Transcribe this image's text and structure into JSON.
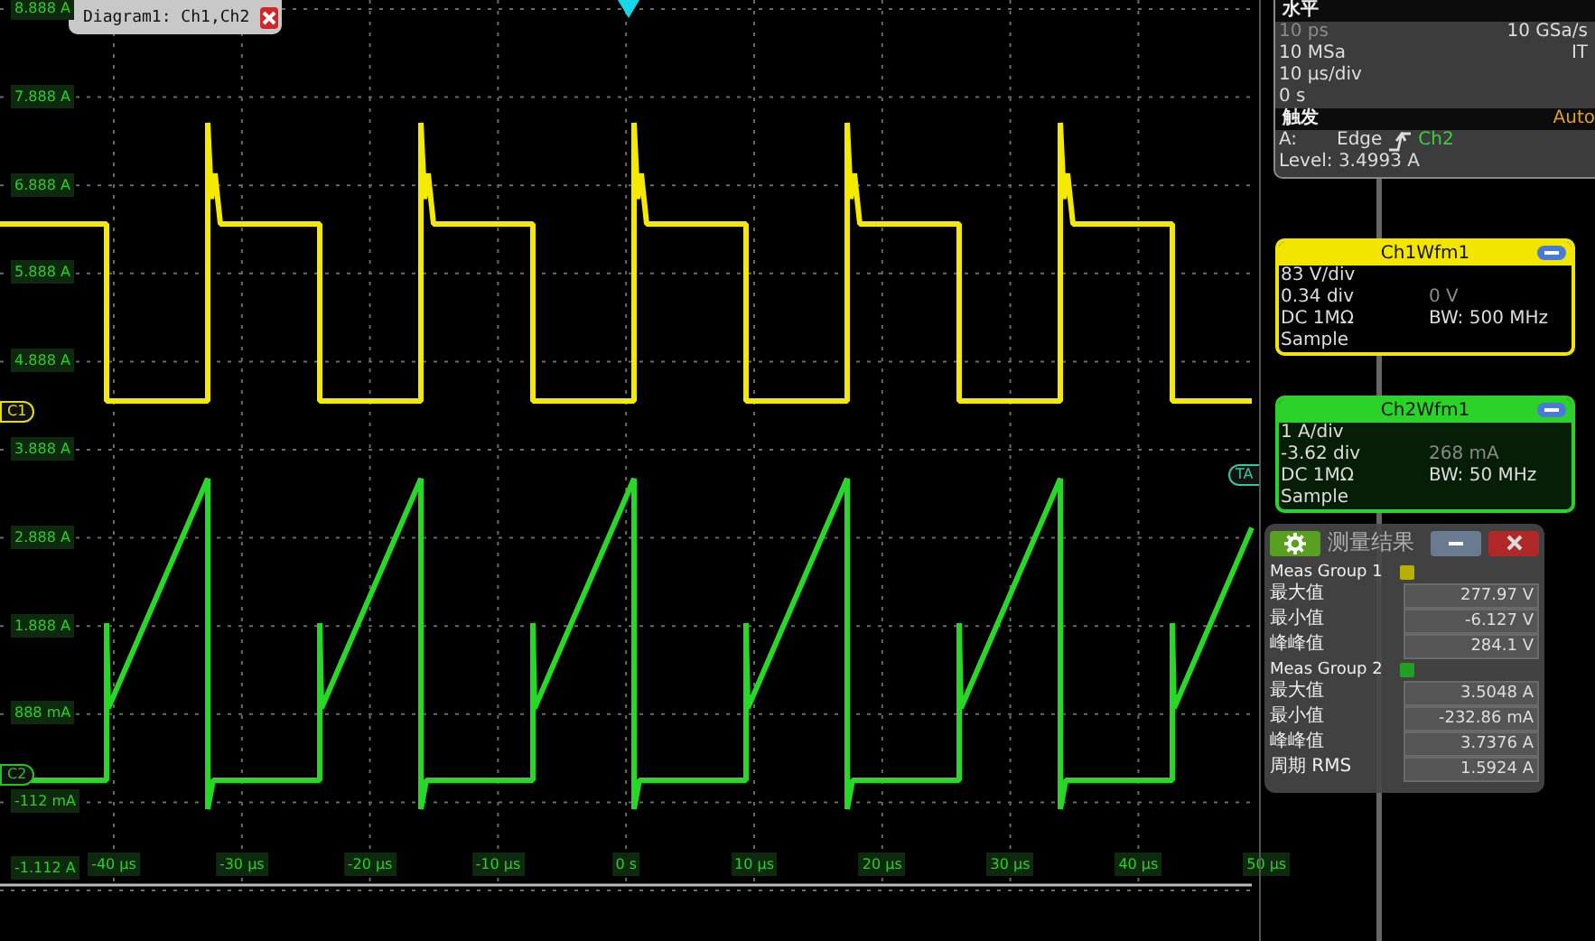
{
  "diagram_tab": {
    "title": "Diagram1: Ch1,Ch2"
  },
  "y_axis_labels": [
    "8.888 A",
    "7.888 A",
    "6.888 A",
    "5.888 A",
    "4.888 A",
    "3.888 A",
    "2.888 A",
    "1.888 A",
    "888 mA",
    "-112 mA",
    "-1.112 A"
  ],
  "x_axis_labels": [
    "-40 µs",
    "-30 µs",
    "-20 µs",
    "-10 µs",
    "0 s",
    "10 µs",
    "20 µs",
    "30 µs",
    "40 µs",
    "50 µs"
  ],
  "channel_tags": [
    {
      "label": "C1",
      "color": "#e8e000",
      "kind": "left"
    },
    {
      "label": "C2",
      "color": "#22c422",
      "kind": "left"
    },
    {
      "label": "TA",
      "color": "#30c8a0",
      "kind": "right"
    }
  ],
  "horizontal": {
    "title": "水平",
    "rows": [
      {
        "left": "10 ps",
        "right": "10 GSa/s",
        "disabled": true
      },
      {
        "left": "10 MSa",
        "right": "IT",
        "disabled": false
      },
      {
        "left": "10 µs/div",
        "disabled": false
      },
      {
        "left": "0 s",
        "disabled": false
      }
    ]
  },
  "trigger": {
    "title": "触发",
    "mode": "Auto",
    "label": "A:",
    "type": "Edge",
    "source": "Ch2",
    "level": "Level: 3.4993 A"
  },
  "channels": [
    {
      "title": "Ch1Wfm1",
      "color": "#f2e600",
      "scale": "83 V/div",
      "position": "0.34 div",
      "offset": "0 V",
      "coupling": "DC 1MΩ",
      "bandwidth": "BW: 500 MHz",
      "mode": "Sample"
    },
    {
      "title": "Ch2Wfm1",
      "color": "#2ad22a",
      "scale": "1 A/div",
      "position": "-3.62 div",
      "offset": "268 mA",
      "coupling": "DC 1MΩ",
      "bandwidth": "BW: 50 MHz",
      "mode": "Sample"
    }
  ],
  "measurements": {
    "title": "测量结果",
    "groups": [
      {
        "name": "Meas Group 1",
        "color": "#b8b000",
        "rows": [
          {
            "label": "最大值",
            "value": "277.97 V"
          },
          {
            "label": "最小值",
            "value": "-6.127 V"
          },
          {
            "label": "峰峰值",
            "value": "284.1 V"
          }
        ]
      },
      {
        "name": "Meas Group 2",
        "color": "#22a022",
        "rows": [
          {
            "label": "最大值",
            "value": "3.5048 A"
          },
          {
            "label": "最小值",
            "value": "-232.86 mA"
          },
          {
            "label": "峰峰值",
            "value": "3.7376 A"
          },
          {
            "label": "周期 RMS",
            "value": "1.5924 A"
          }
        ]
      }
    ]
  }
}
